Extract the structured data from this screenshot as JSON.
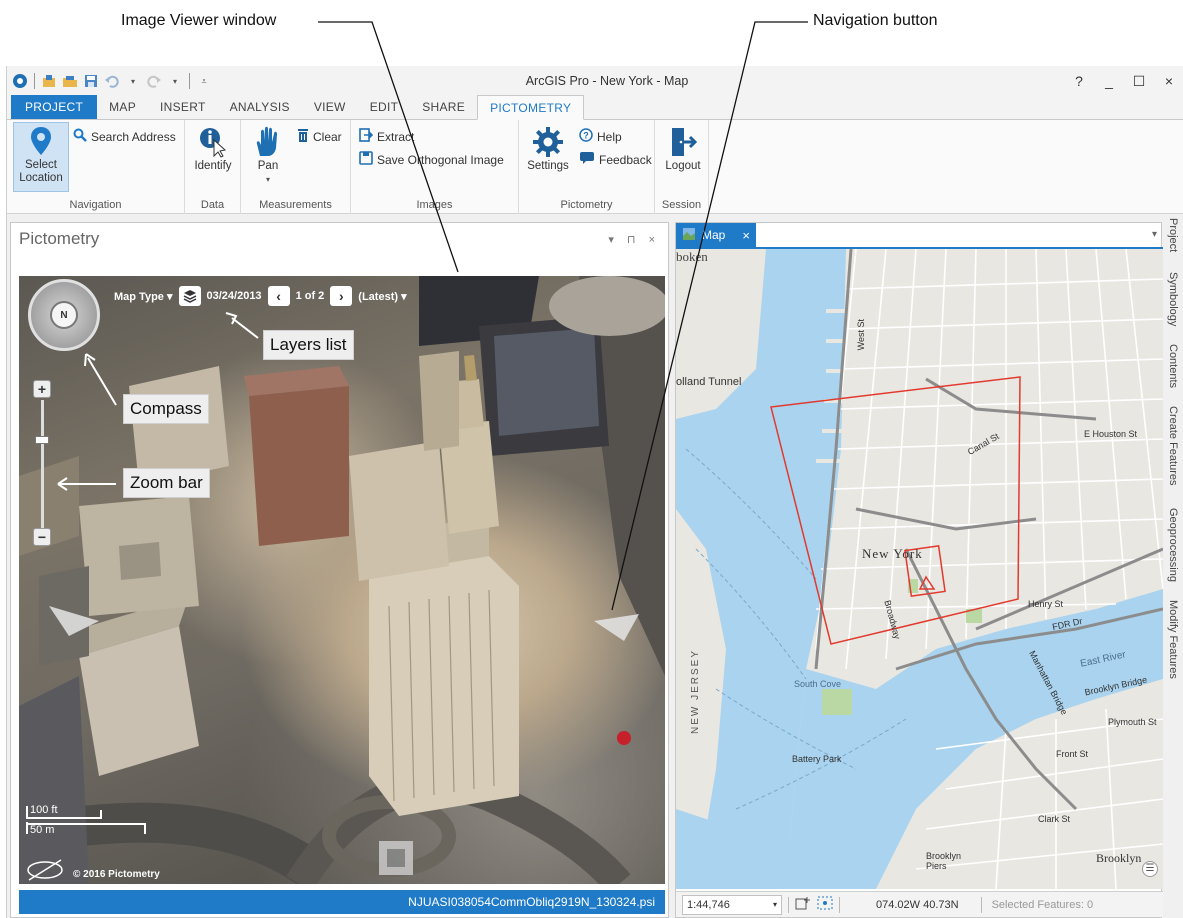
{
  "callouts": {
    "image_viewer": "Image Viewer window",
    "navigation_button": "Navigation button",
    "layers_list": "Layers list",
    "compass": "Compass",
    "zoom_bar": "Zoom bar"
  },
  "window": {
    "title": "ArcGIS Pro - New York - Map",
    "help": "?",
    "minimize": "_",
    "maximize": "☐",
    "close": "×"
  },
  "tabs": [
    "PROJECT",
    "MAP",
    "INSERT",
    "ANALYSIS",
    "VIEW",
    "EDIT",
    "SHARE",
    "PICTOMETRY"
  ],
  "ribbon": {
    "navigation": {
      "select_location": "Select Location",
      "search_address": "Search Address",
      "label": "Navigation"
    },
    "data": {
      "identify": "Identify",
      "label": "Data"
    },
    "measurements": {
      "pan": "Pan",
      "clear": "Clear",
      "label": "Measurements"
    },
    "images": {
      "extract": "Extract",
      "save_orthogonal": "Save Orthogonal Image",
      "label": "Images"
    },
    "pictometry": {
      "settings": "Settings",
      "help": "Help",
      "feedback": "Feedback",
      "label": "Pictometry"
    },
    "session": {
      "logout": "Logout",
      "label": "Session"
    }
  },
  "pictometry_pane": {
    "title": "Pictometry",
    "controls": "▾ ⊓ ×",
    "toolbar": {
      "map_type": "Map Type ▾",
      "date": "03/24/2013",
      "page": "1 of 2",
      "latest": "(Latest) ▾"
    },
    "compass_label": "N",
    "scale_ft": "100 ft",
    "scale_m": "50 m",
    "copyright": "© 2016 Pictometry",
    "filename": "NJUASI038054CommObliq2919N_130324.psi"
  },
  "map_pane": {
    "tab_label": "Map",
    "scale": "1:44,746",
    "coordinates": "074.02W 40.73N",
    "selected_features": "Selected Features: 0",
    "labels": {
      "new_york": "New York",
      "new_jersey": "NEW JERSEY",
      "hoboken": "boken",
      "holland_tunnel": "olland Tunnel",
      "west_st": "West St",
      "fdr": "FDR Dr",
      "east_river": "East River",
      "south_cove": "South Cove",
      "battery_park": "Battery Park",
      "brooklyn": "Brooklyn",
      "brooklyn_piers": "Brooklyn Piers",
      "brooklyn_bridge": "Brooklyn Bridge",
      "manhattan_bridge": "Manhattan Bridge",
      "canal_st": "Canal St",
      "houston_st": "E Houston St",
      "broadway": "Broadway",
      "front_st": "Front St",
      "plymouth_st": "Plymouth St",
      "henry_st": "Henry St",
      "clark_st": "Clark St"
    }
  },
  "side_tabs": [
    "Project",
    "Symbology",
    "Contents",
    "Create Features",
    "Geoprocessing",
    "Modify Features"
  ]
}
